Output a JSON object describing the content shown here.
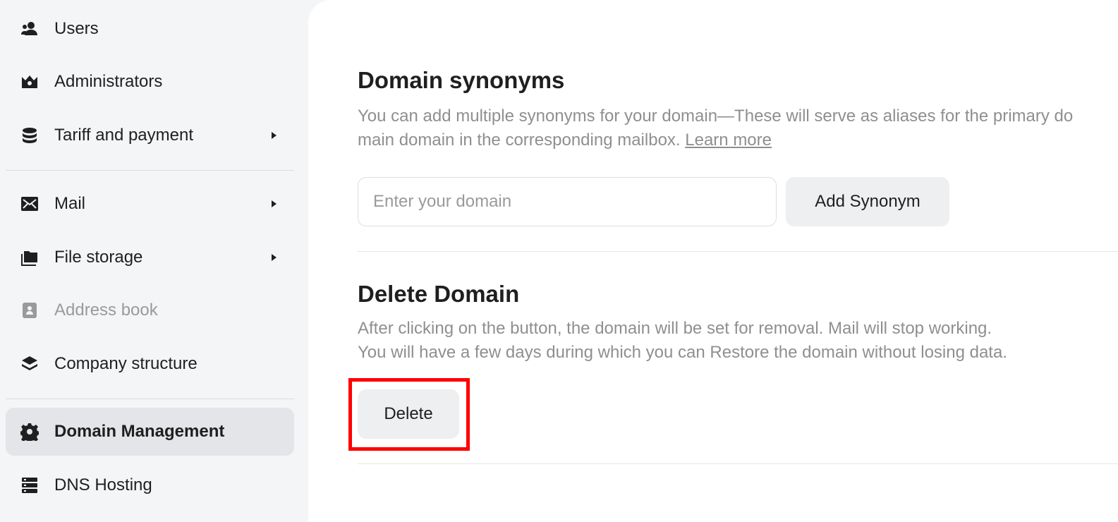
{
  "sidebar": {
    "items": [
      {
        "label": "Users",
        "icon": "users-icon"
      },
      {
        "label": "Administrators",
        "icon": "crown-icon"
      },
      {
        "label": "Tariff and payment",
        "icon": "database-coins-icon"
      },
      {
        "label": "Mail",
        "icon": "mail-icon"
      },
      {
        "label": "File storage",
        "icon": "folders-icon"
      },
      {
        "label": "Address book",
        "icon": "address-book-icon"
      },
      {
        "label": "Company structure",
        "icon": "layers-icon"
      },
      {
        "label": "Domain Management",
        "icon": "gear-icon"
      },
      {
        "label": "DNS Hosting",
        "icon": "server-icon"
      }
    ]
  },
  "main": {
    "synonyms": {
      "title": "Domain synonyms",
      "description_line1": "You can add multiple synonyms for your domain—These will serve as aliases for the primary do",
      "description_line2": "main domain in the corresponding mailbox.",
      "learn_more": "Learn more",
      "input_placeholder": "Enter your domain",
      "input_value": "",
      "add_button": "Add Synonym"
    },
    "delete": {
      "title": "Delete Domain",
      "description_line1": "After clicking on the button, the domain will be set for removal. Mail will stop working.",
      "description_line2": "You will have a few days during which you can Restore the domain without losing data.",
      "delete_button": "Delete"
    }
  },
  "colors": {
    "highlight": "#ff0000",
    "active_nav_bg": "#e4e5e8",
    "button_bg": "#eeeff1"
  }
}
